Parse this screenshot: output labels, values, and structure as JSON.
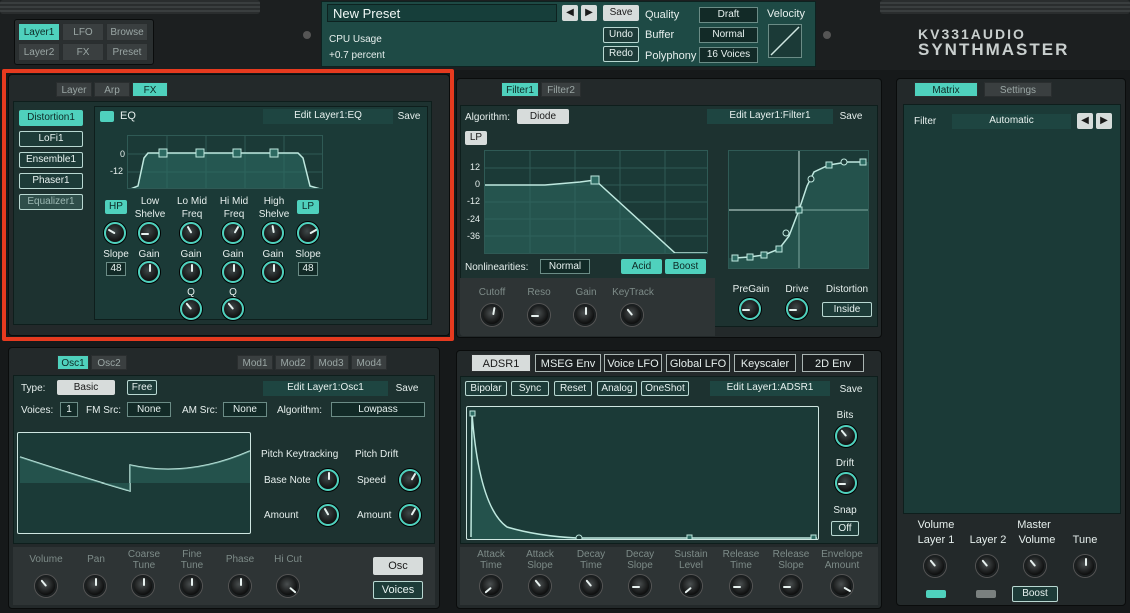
{
  "top": {
    "nav": [
      "Layer1",
      "LFO",
      "Browse",
      "Layer2",
      "FX",
      "Preset"
    ],
    "preset_name": "New Preset",
    "save": "Save",
    "undo": "Undo",
    "redo": "Redo",
    "cpu_label": "CPU Usage",
    "cpu_value": "+0.7 percent",
    "quality_label": "Quality",
    "quality": "Draft",
    "buffer_label": "Buffer",
    "buffer": "Normal",
    "polyphony_label": "Polyphony",
    "polyphony": "16 Voices",
    "velocity_label": "Velocity",
    "brand1": "KV331AUDIO",
    "brand2": "SYNTHMASTER"
  },
  "fx": {
    "tabs": [
      "Layer",
      "Arp",
      "FX"
    ],
    "effects": [
      "Distortion1",
      "LoFi1",
      "Ensemble1",
      "Phaser1",
      "Equalizer1"
    ],
    "eq_title": "EQ",
    "edit": "Edit Layer1:EQ",
    "save": "Save",
    "y_ticks": [
      "0",
      "-12"
    ],
    "hp": "HP",
    "lp": "LP",
    "bands": [
      "Low\nShelve",
      "Lo Mid\nFreq",
      "Hi Mid\nFreq",
      "High\nShelve"
    ],
    "slope": "Slope",
    "gain": "Gain",
    "q": "Q",
    "slope_val": "48"
  },
  "filter": {
    "tabs": [
      "Filter1",
      "Filter2"
    ],
    "algorithm_label": "Algorithm:",
    "algorithm": "Diode",
    "edit": "Edit Layer1:Filter1",
    "save": "Save",
    "mode": "LP",
    "y_ticks": [
      "12",
      "0",
      "-12",
      "-24",
      "-36"
    ],
    "nonlin_label": "Nonlinearities:",
    "nonlin": "Normal",
    "acid": "Acid",
    "boost": "Boost",
    "knobs": [
      "Cutoff",
      "Reso",
      "Gain",
      "KeyTrack"
    ],
    "pregain": "PreGain",
    "drive": "Drive",
    "distortion_label": "Distortion",
    "distortion": "Inside"
  },
  "matrix": {
    "tabs": [
      "Matrix",
      "Settings"
    ],
    "filter_label": "Filter",
    "filter": "Automatic"
  },
  "osc": {
    "tabs": [
      "Osc1",
      "Osc2"
    ],
    "mod_tabs": [
      "Mod1",
      "Mod2",
      "Mod3",
      "Mod4"
    ],
    "type_label": "Type:",
    "type": "Basic",
    "free": "Free",
    "edit": "Edit Layer1:Osc1",
    "save": "Save",
    "voices_label": "Voices:",
    "voices": "1",
    "fm_label": "FM Src:",
    "fm": "None",
    "am_label": "AM Src:",
    "am": "None",
    "algorithm_label": "Algorithm:",
    "algorithm": "Lowpass",
    "pitch_key": "Pitch Keytracking",
    "pitch_drift": "Pitch Drift",
    "base_note": "Base Note",
    "amount": "Amount",
    "speed": "Speed",
    "knobs": [
      "Volume",
      "Pan",
      "Coarse\nTune",
      "Fine\nTune",
      "Phase",
      "Hi Cut"
    ],
    "osc_btn": "Osc",
    "voices_btn": "Voices"
  },
  "env": {
    "tabs": [
      "ADSR1",
      "MSEG Env",
      "Voice LFO",
      "Global LFO",
      "Keyscaler",
      "2D Env"
    ],
    "buttons": [
      "Bipolar",
      "Sync",
      "Reset",
      "Analog",
      "OneShot"
    ],
    "edit": "Edit Layer1:ADSR1",
    "save": "Save",
    "bits": "Bits",
    "drift": "Drift",
    "snap": "Snap",
    "snap_val": "Off",
    "knobs": [
      "Attack\nTime",
      "Attack\nSlope",
      "Decay\nTime",
      "Decay\nSlope",
      "Sustain\nLevel",
      "Release\nTime",
      "Release\nSlope",
      "Envelope\nAmount"
    ]
  },
  "master": {
    "volume": "Volume",
    "master": "Master",
    "knobs": [
      "Layer 1",
      "Layer 2",
      "Volume",
      "Tune"
    ],
    "boost": "Boost"
  },
  "colors": {
    "accent": "#4fd1bd",
    "panel": "#23292a",
    "display": "#1b3a37",
    "highlight": "#e63a1f"
  }
}
